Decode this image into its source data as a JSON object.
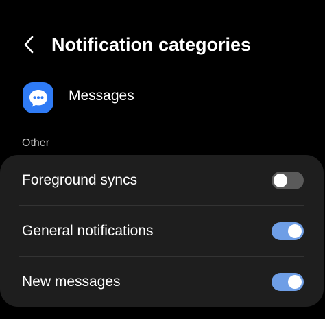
{
  "header": {
    "title": "Notification categories",
    "back_icon": "chevron-left-icon"
  },
  "app": {
    "name": "Messages",
    "icon": "chat-bubble-icon",
    "icon_color": "#2f7bf5"
  },
  "section": {
    "label": "Other"
  },
  "categories": [
    {
      "label": "Foreground syncs",
      "enabled": false
    },
    {
      "label": "General notifications",
      "enabled": true
    },
    {
      "label": "New messages",
      "enabled": true
    }
  ],
  "colors": {
    "background": "#000000",
    "card": "#1e1e1e",
    "toggle_on": "#6e9ee6",
    "toggle_off": "#5a5a5a"
  }
}
